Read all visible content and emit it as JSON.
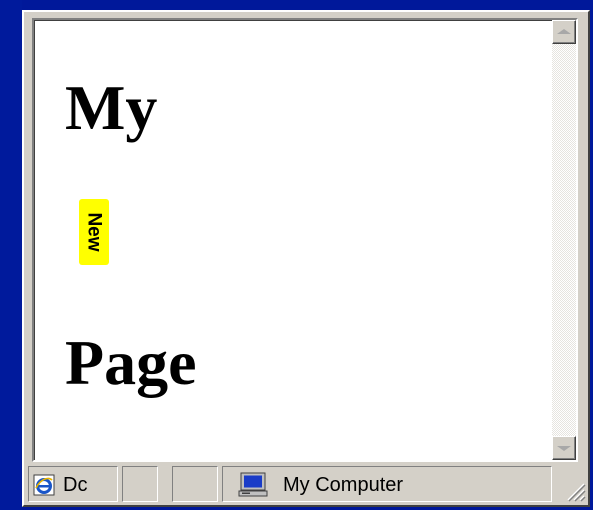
{
  "document": {
    "heading_top": "My",
    "badge": "New",
    "heading_bottom": "Page"
  },
  "statusbar": {
    "document_text": "Dc",
    "zone_text": "My Computer"
  },
  "colors": {
    "desktop": "#00189a",
    "window_face": "#d4d0c8",
    "badge_bg": "#ffff00",
    "document_bg": "#ffffff"
  },
  "icons": {
    "status_document": "internet-explorer-page-icon",
    "zone": "my-computer-icon",
    "scroll_up": "scroll-up-arrow-icon",
    "scroll_down": "scroll-down-arrow-icon",
    "resize": "resize-grip-icon"
  }
}
